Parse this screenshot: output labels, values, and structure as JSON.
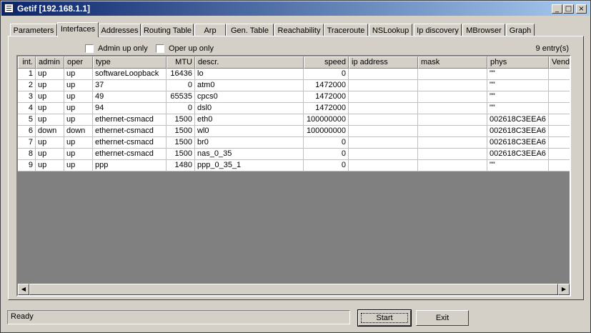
{
  "window": {
    "title": "Getif [192.168.1.1]"
  },
  "title_buttons": {
    "minimize": "_",
    "maximize": "□",
    "close": "×"
  },
  "tabs": [
    {
      "label": "Parameters"
    },
    {
      "label": "Interfaces"
    },
    {
      "label": "Addresses"
    },
    {
      "label": "Routing Table"
    },
    {
      "label": "Arp"
    },
    {
      "label": "Gen. Table"
    },
    {
      "label": "Reachability"
    },
    {
      "label": "Traceroute"
    },
    {
      "label": "NSLookup"
    },
    {
      "label": "Ip discovery"
    },
    {
      "label": "MBrowser"
    },
    {
      "label": "Graph"
    }
  ],
  "active_tab": "Interfaces",
  "filters": {
    "admin_up_only": "Admin up only",
    "oper_up_only": "Oper up only",
    "admin_checked": false,
    "oper_checked": false
  },
  "entry_count": "9 entry(s)",
  "table": {
    "columns": [
      "int.",
      "admin",
      "oper",
      "type",
      "MTU",
      "descr.",
      "speed",
      "ip address",
      "mask",
      "phys",
      "Vendo"
    ],
    "rows": [
      [
        "1",
        "up",
        "up",
        "softwareLoopback",
        "16436",
        "lo",
        "0",
        "",
        "",
        "\"\"",
        ""
      ],
      [
        "2",
        "up",
        "up",
        "37",
        "0",
        "atm0",
        "1472000",
        "",
        "",
        "\"\"",
        ""
      ],
      [
        "3",
        "up",
        "up",
        "49",
        "65535",
        "cpcs0",
        "1472000",
        "",
        "",
        "\"\"",
        ""
      ],
      [
        "4",
        "up",
        "up",
        "94",
        "0",
        "dsl0",
        "1472000",
        "",
        "",
        "\"\"",
        ""
      ],
      [
        "5",
        "up",
        "up",
        "ethernet-csmacd",
        "1500",
        "eth0",
        "100000000",
        "",
        "",
        "002618C3EEA6",
        ""
      ],
      [
        "6",
        "down",
        "down",
        "ethernet-csmacd",
        "1500",
        "wl0",
        "100000000",
        "",
        "",
        "002618C3EEA6",
        ""
      ],
      [
        "7",
        "up",
        "up",
        "ethernet-csmacd",
        "1500",
        "br0",
        "0",
        "",
        "",
        "002618C3EEA6",
        ""
      ],
      [
        "8",
        "up",
        "up",
        "ethernet-csmacd",
        "1500",
        "nas_0_35",
        "0",
        "",
        "",
        "002618C3EEA6",
        ""
      ],
      [
        "9",
        "up",
        "up",
        "ppp",
        "1480",
        "ppp_0_35_1",
        "0",
        "",
        "",
        "\"\"",
        ""
      ]
    ]
  },
  "scroll": {
    "left": "◀",
    "right": "▶"
  },
  "status": {
    "text": "Ready"
  },
  "buttons": {
    "start": "Start",
    "exit": "Exit"
  }
}
